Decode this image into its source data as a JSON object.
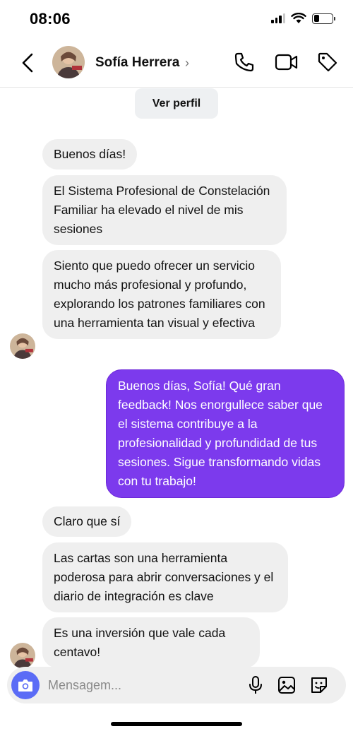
{
  "status_bar": {
    "time": "08:06",
    "icons": [
      "signal-icon",
      "wifi-icon",
      "battery-icon"
    ],
    "battery_level": 0.3
  },
  "header": {
    "back_icon": "chevron-left-icon",
    "contact_name": "Sofía Herrera",
    "name_chevron": "›",
    "actions": [
      "phone-icon",
      "video-camera-icon",
      "tag-icon"
    ]
  },
  "profile_button": {
    "label": "Ver perfil"
  },
  "messages": [
    {
      "direction": "incoming",
      "text": "Buenos días!"
    },
    {
      "direction": "incoming",
      "text": "El Sistema Profesional de Constelación Familiar ha elevado el nivel de mis sesiones"
    },
    {
      "direction": "incoming",
      "text": "Siento que puedo ofrecer un servicio mucho más profesional y profundo, explorando los patrones familiares con una herramienta tan visual y efectiva"
    },
    {
      "direction": "outgoing",
      "text": "Buenos días, Sofía! Qué gran feedback! Nos enorgullece saber que el sistema contribuye a la profesionalidad y profundidad de tus sesiones. Sigue transformando vidas con tu trabajo!"
    },
    {
      "direction": "incoming",
      "text": "Claro que sí"
    },
    {
      "direction": "incoming",
      "text": "Las cartas son una herramienta poderosa para abrir conversaciones y el diario de integración es clave"
    },
    {
      "direction": "incoming",
      "text": "Es una inversión que vale cada centavo!"
    }
  ],
  "composer": {
    "placeholder": "Mensagem...",
    "icons": [
      "camera-icon",
      "microphone-icon",
      "image-icon",
      "sticker-icon"
    ]
  },
  "colors": {
    "outgoing_bubble": "#7c3aed",
    "incoming_bubble": "#efefef",
    "camera_button": "#5b6cf6"
  }
}
